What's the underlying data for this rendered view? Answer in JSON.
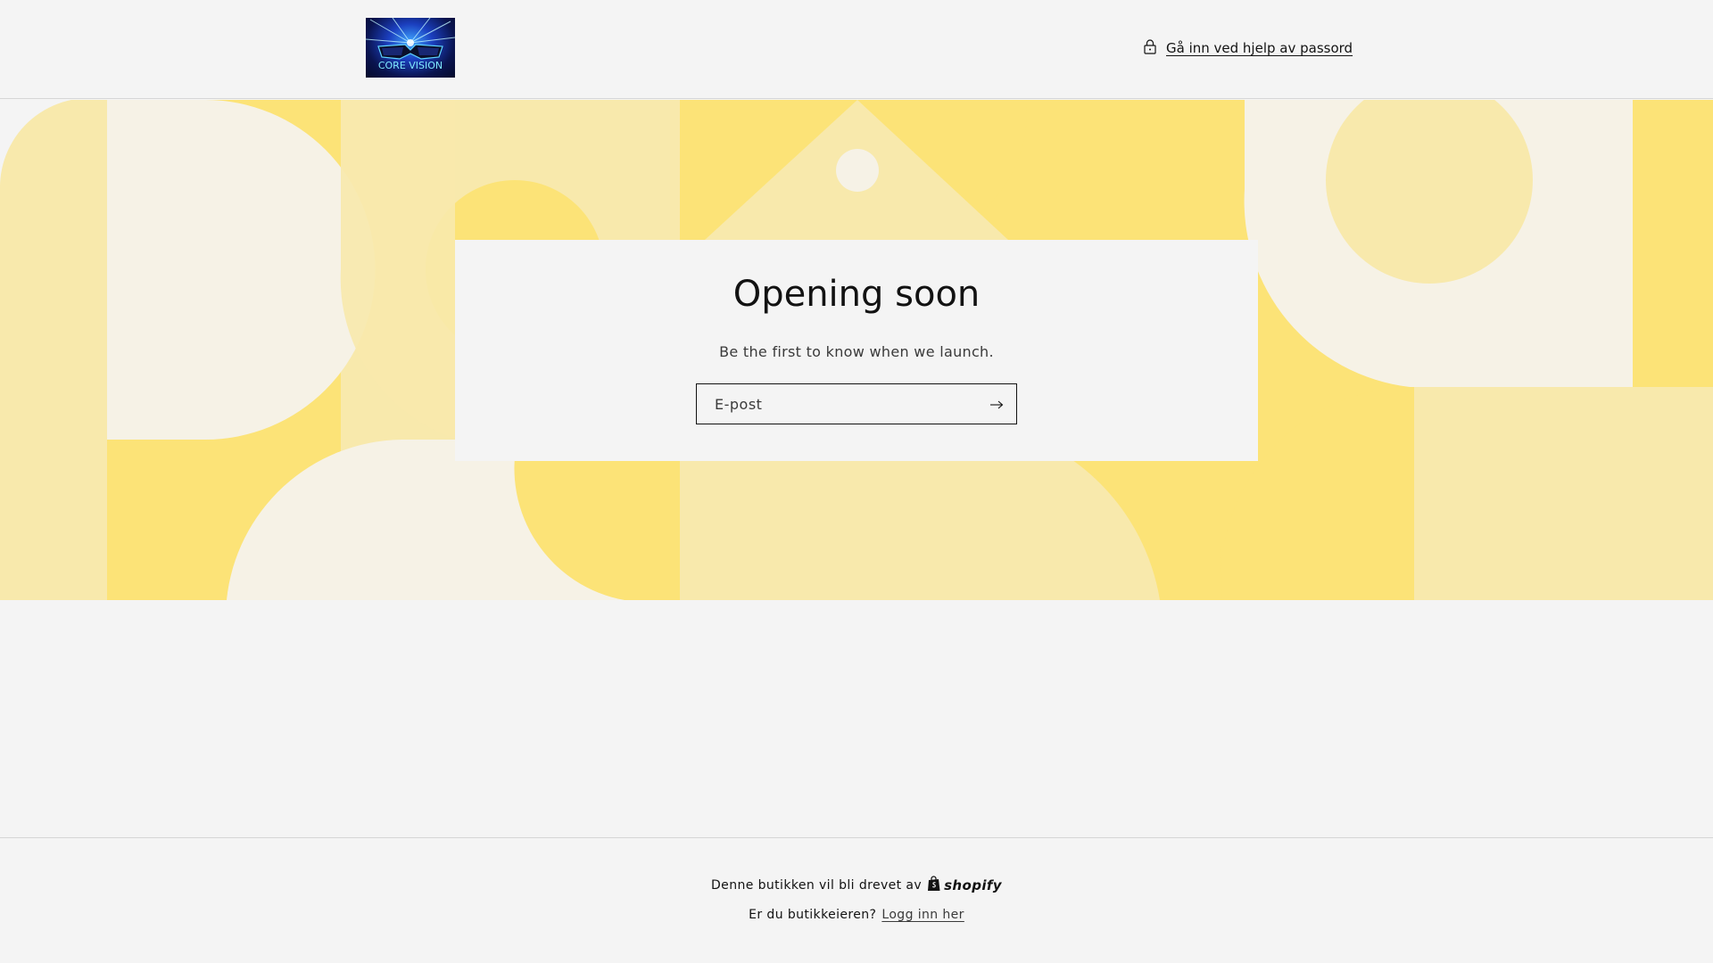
{
  "header": {
    "logo_text": "CORE VISION",
    "password_link": "Gå inn ved hjelp av passord"
  },
  "main": {
    "title": "Opening soon",
    "subtitle": "Be the first to know when we launch.",
    "email_placeholder": "E-post"
  },
  "footer": {
    "powered_by": "Denne butikken vil bli drevet av",
    "shopify_label": "shopify",
    "owner_question": "Er du butikkeieren?",
    "login_link": "Logg inn her"
  },
  "colors": {
    "background": "#f4f4f4",
    "banner_yellow": "#fce377",
    "banner_pale": "#f8e9ac",
    "banner_cream": "#f6f2e6",
    "text": "#121212"
  },
  "icons": {
    "password": "lock-icon",
    "submit": "arrow-right-icon",
    "shopify": "shopping-bag-icon"
  }
}
